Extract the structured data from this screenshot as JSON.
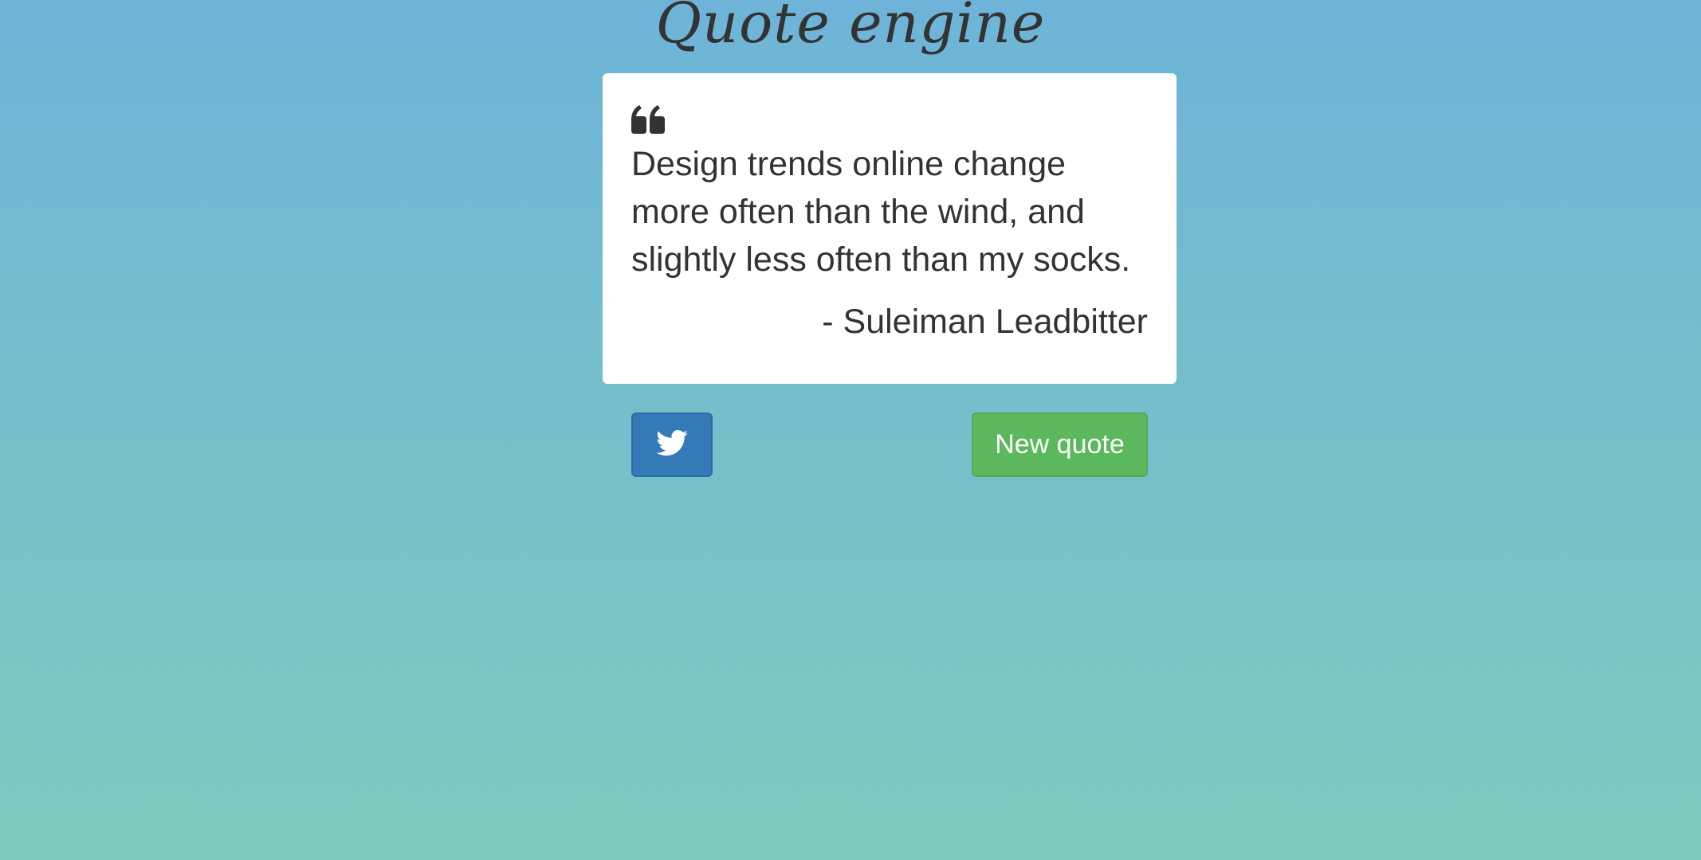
{
  "app": {
    "title": "Quote engine"
  },
  "quote": {
    "text": "Design trends online change more often than the wind, and slightly less often than my socks.",
    "author": "- Suleiman Leadbitter",
    "icon": "quote-left-icon"
  },
  "actions": {
    "tweet_icon": "twitter-icon",
    "new_quote_label": "New quote"
  },
  "colors": {
    "background_top": "#6db4d8",
    "background_bottom": "#7ccbbd",
    "card": "#ffffff",
    "text": "#333333",
    "twitter_button": "#337ab7",
    "new_quote_button": "#5cb85c"
  }
}
